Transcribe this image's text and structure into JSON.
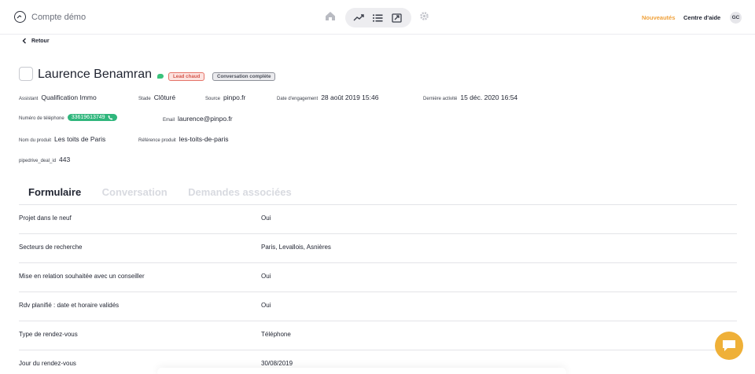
{
  "topbar": {
    "account_name": "Compte démo",
    "news_label": "Nouveautés",
    "help_label": "Centre d'aide",
    "avatar_initials": "GC",
    "accent_color": "#f0a13a"
  },
  "back_label": "Retour",
  "contact": {
    "name": "Laurence Benamran",
    "badges": [
      "Lead chaud",
      "Conversation complète"
    ],
    "meta": {
      "assistant_key": "Assistant",
      "assistant_value": "Qualification Immo",
      "stage_key": "Stade",
      "stage_value": "Clôturé",
      "source_key": "Source",
      "source_value": "pinpo.fr",
      "engagement_key": "Date d'engagement",
      "engagement_value": "28 août 2019 15:46",
      "activity_key": "Dernière activité",
      "activity_value": "15 déc. 2020 16:54",
      "phone_key": "Numéro de téléphone",
      "phone_value": "33619613749",
      "email_key": "Email",
      "email_value": "laurence@pinpo.fr",
      "product_key": "Nom du produit",
      "product_value": "Les toits de Paris",
      "ref_key": "Référence produit",
      "ref_value": "les-toits-de-paris",
      "deal_key": "pipedrive_deal_id",
      "deal_value": "443"
    }
  },
  "tabs": [
    "Formulaire",
    "Conversation",
    "Demandes associées"
  ],
  "form_rows": [
    {
      "question": "Projet dans le neuf",
      "answer": "Oui"
    },
    {
      "question": "Secteurs de recherche",
      "answer": "Paris, Levallois, Asnières"
    },
    {
      "question": "Mise en relation souhaitée avec un conseiller",
      "answer": "Oui"
    },
    {
      "question": "Rdv planifié : date et horaire validés",
      "answer": "Oui"
    },
    {
      "question": "Type de rendez-vous",
      "answer": "Téléphone"
    },
    {
      "question": "Jour du rendez-vous",
      "answer": "30/08/2019"
    }
  ]
}
